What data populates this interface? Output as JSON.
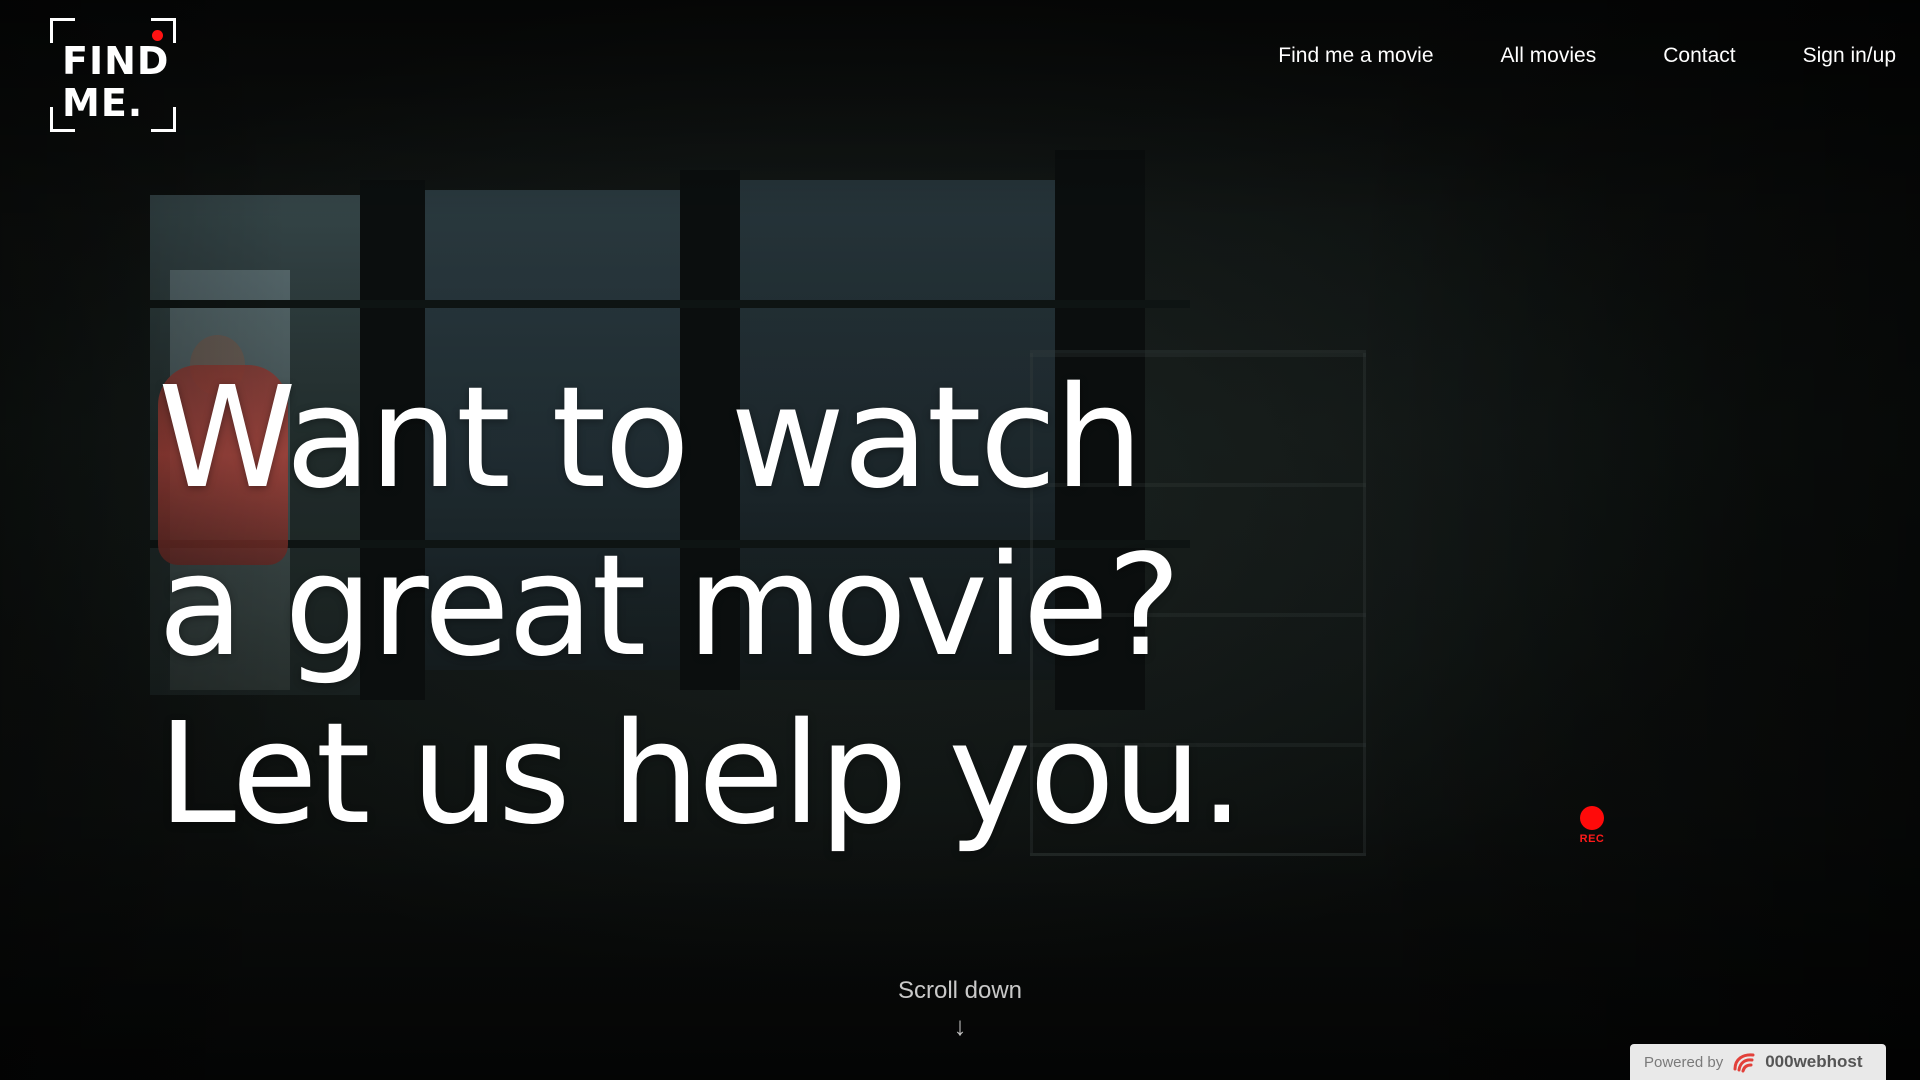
{
  "brand": {
    "logo_line1": "FIND",
    "logo_line2": "ME.",
    "accent_color": "#ff1212"
  },
  "nav": {
    "items": [
      {
        "label": "Find me a movie"
      },
      {
        "label": "All movies"
      },
      {
        "label": "Contact"
      },
      {
        "label": "Sign in/up"
      }
    ]
  },
  "hero": {
    "line1": "Want to watch",
    "line2": "a great movie?",
    "line3": "Let us help you."
  },
  "rec": {
    "label": "REC",
    "icon": "record-dot-icon"
  },
  "scroll": {
    "label": "Scroll down",
    "arrow": "↓",
    "icon": "arrow-down-icon"
  },
  "badge": {
    "prefix": "Powered by",
    "brand": "000webhost",
    "icon": "webhost-logo-icon"
  }
}
